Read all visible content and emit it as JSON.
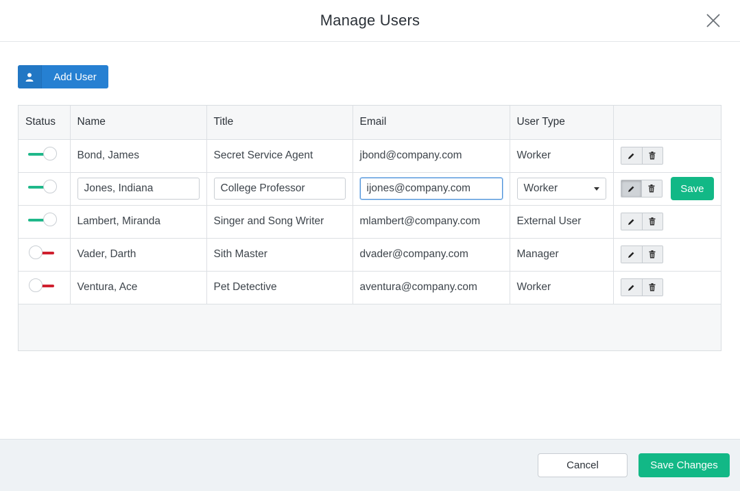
{
  "dialog": {
    "title": "Manage Users",
    "close_icon": "close-icon"
  },
  "toolbar": {
    "add_user_label": "Add User",
    "add_user_icon": "user-icon"
  },
  "table": {
    "columns": [
      "Status",
      "Name",
      "Title",
      "Email",
      "User Type",
      ""
    ],
    "rows": [
      {
        "status": "active",
        "name": "Bond, James",
        "title": "Secret Service Agent",
        "email": "jbond@company.com",
        "user_type": "Worker"
      },
      {
        "status": "active",
        "name": "Jones, Indiana",
        "title": "College Professor",
        "email": "ijones@company.com",
        "user_type": "Worker",
        "editing": true,
        "save_label": "Save"
      },
      {
        "status": "active",
        "name": "Lambert, Miranda",
        "title": "Singer and Song Writer",
        "email": "mlambert@company.com",
        "user_type": "External User"
      },
      {
        "status": "inactive",
        "name": "Vader, Darth",
        "title": "Sith Master",
        "email": "dvader@company.com",
        "user_type": "Manager"
      },
      {
        "status": "inactive",
        "name": "Ventura, Ace",
        "title": "Pet Detective",
        "email": "aventura@company.com",
        "user_type": "Worker"
      }
    ],
    "row_action_icons": [
      "pencil-icon",
      "trash-icon"
    ]
  },
  "footer": {
    "cancel_label": "Cancel",
    "save_changes_label": "Save Changes"
  },
  "colors": {
    "primary_blue": "#2680d2",
    "success_green": "#12b886",
    "toggle_on": "#1fb88a",
    "toggle_off": "#cf1f2e"
  }
}
